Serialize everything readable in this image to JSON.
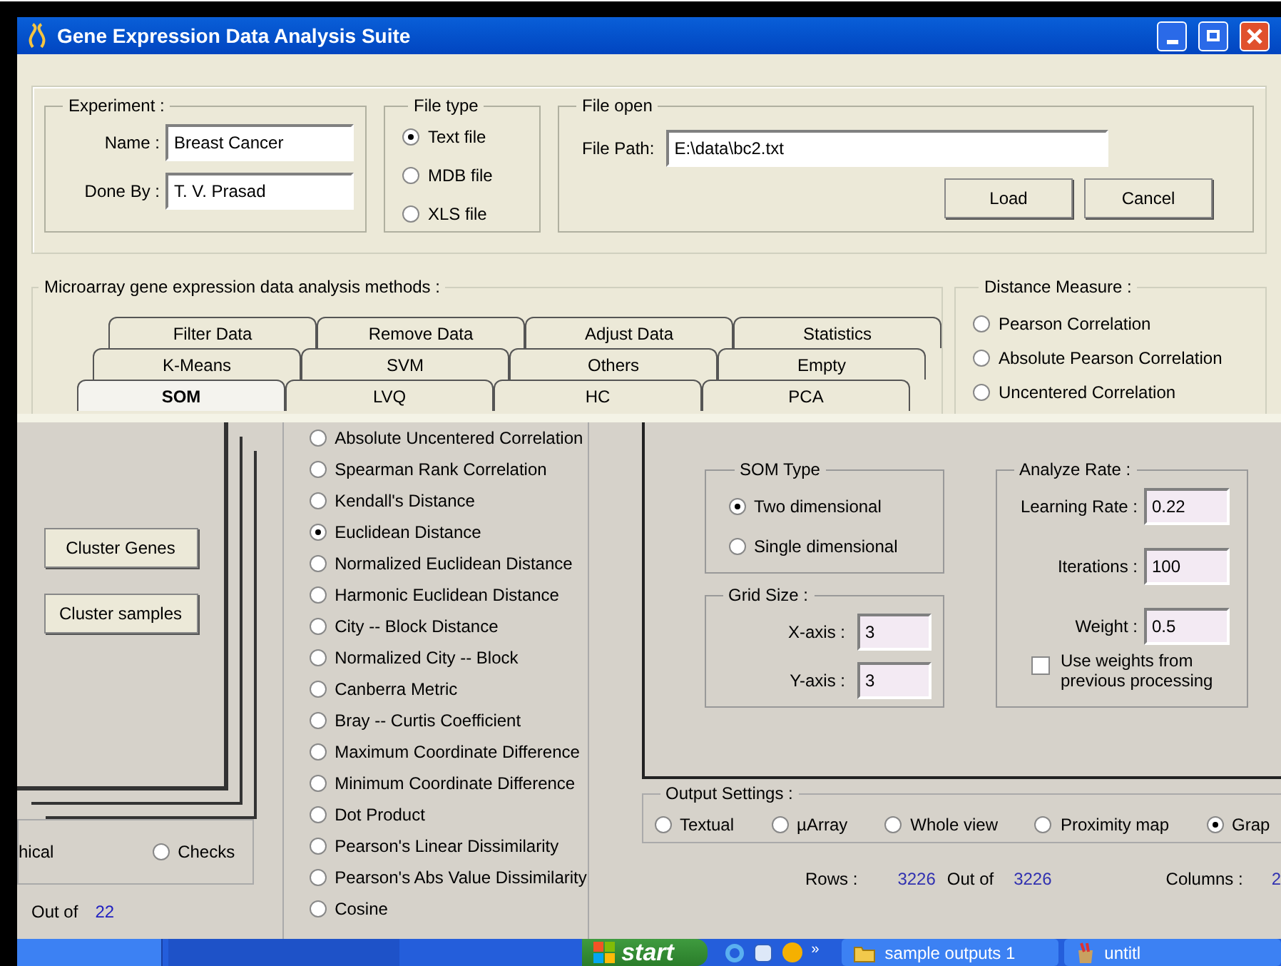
{
  "window": {
    "title": "Gene Expression Data Analysis Suite"
  },
  "experiment": {
    "legend": "Experiment :",
    "fields": [
      {
        "label": "Name :",
        "value": "Breast Cancer"
      },
      {
        "label": "Done By :",
        "value": "T. V. Prasad"
      }
    ]
  },
  "file_type": {
    "legend": "File type",
    "options": [
      {
        "label": "Text file",
        "selected": true
      },
      {
        "label": "MDB file",
        "selected": false
      },
      {
        "label": "XLS file",
        "selected": false
      }
    ]
  },
  "file_open": {
    "legend": "File open",
    "label": "File Path:",
    "value": "E:\\data\\bc2.txt",
    "buttons": [
      "Load",
      "Cancel"
    ]
  },
  "methods": {
    "legend": "Microarray gene expression data analysis methods :",
    "tab_rows": [
      [
        {
          "label": "Filter Data",
          "selected": false
        },
        {
          "label": "Remove Data",
          "selected": false
        },
        {
          "label": "Adjust Data",
          "selected": false
        },
        {
          "label": "Statistics",
          "selected": false
        }
      ],
      [
        {
          "label": "K-Means",
          "selected": false
        },
        {
          "label": "SVM",
          "selected": false
        },
        {
          "label": "Others",
          "selected": false
        },
        {
          "label": "Empty",
          "selected": false
        }
      ],
      [
        {
          "label": "SOM",
          "selected": true
        },
        {
          "label": "LVQ",
          "selected": false
        },
        {
          "label": "HC",
          "selected": false
        },
        {
          "label": "PCA",
          "selected": false
        }
      ]
    ]
  },
  "distance_measure": {
    "legend": "Distance Measure :",
    "options": [
      {
        "label": "Pearson Correlation",
        "selected": false
      },
      {
        "label": "Absolute Pearson Correlation",
        "selected": false
      },
      {
        "label": "Uncentered Correlation",
        "selected": false
      }
    ]
  },
  "left_panel": {
    "buttons": [
      "Cluster Genes",
      "Cluster samples"
    ],
    "cut_label": "hical",
    "options": [
      {
        "label": "Checks",
        "selected": false
      }
    ],
    "count_label": "Out of",
    "count": "22"
  },
  "distance_list": [
    {
      "label": "Absolute Uncentered Correlation",
      "selected": false
    },
    {
      "label": "Spearman Rank Correlation",
      "selected": false
    },
    {
      "label": "Kendall's Distance",
      "selected": false
    },
    {
      "label": "Euclidean Distance",
      "selected": true
    },
    {
      "label": "Normalized Euclidean Distance",
      "selected": false
    },
    {
      "label": "Harmonic Euclidean Distance",
      "selected": false
    },
    {
      "label": "City -- Block Distance",
      "selected": false
    },
    {
      "label": "Normalized City -- Block",
      "selected": false
    },
    {
      "label": "Canberra Metric",
      "selected": false
    },
    {
      "label": "Bray -- Curtis Coefficient",
      "selected": false
    },
    {
      "label": "Maximum Coordinate Difference",
      "selected": false
    },
    {
      "label": "Minimum Coordinate Difference",
      "selected": false
    },
    {
      "label": "Dot Product",
      "selected": false
    },
    {
      "label": "Pearson's Linear Dissimilarity",
      "selected": false
    },
    {
      "label": "Pearson's Abs Value Dissimilarity",
      "selected": false
    },
    {
      "label": "Cosine",
      "selected": false
    }
  ],
  "som_type": {
    "legend": "SOM Type",
    "options": [
      {
        "label": "Two dimensional",
        "selected": true
      },
      {
        "label": "Single dimensional",
        "selected": false
      }
    ]
  },
  "grid_size": {
    "legend": "Grid Size :",
    "fields": [
      {
        "label": "X-axis :",
        "value": "3"
      },
      {
        "label": "Y-axis :",
        "value": "3"
      }
    ]
  },
  "analyze_rate": {
    "legend": "Analyze Rate :",
    "fields": [
      {
        "label": "Learning Rate :",
        "value": "0.22"
      },
      {
        "label": "Iterations :",
        "value": "100"
      },
      {
        "label": "Weight :",
        "value": "0.5"
      }
    ],
    "checkbox": {
      "label": "Use weights from previous processing",
      "checked": false
    }
  },
  "output_settings": {
    "legend": "Output Settings :",
    "options": [
      {
        "label": "Textual",
        "selected": false
      },
      {
        "label": "µArray",
        "selected": false
      },
      {
        "label": "Whole view",
        "selected": false
      },
      {
        "label": "Proximity map",
        "selected": false
      },
      {
        "label": "Grap",
        "selected": true
      }
    ]
  },
  "summary": {
    "rows_label": "Rows :",
    "rows": "3226",
    "out_of": "Out of",
    "total": "3226",
    "columns_label": "Columns :",
    "columns": "2"
  },
  "taskbar": {
    "start": "start",
    "more": "»",
    "windows": [
      {
        "label": "sample outputs 1",
        "kind": "folder"
      },
      {
        "label": "untitl",
        "kind": "paint"
      }
    ]
  }
}
